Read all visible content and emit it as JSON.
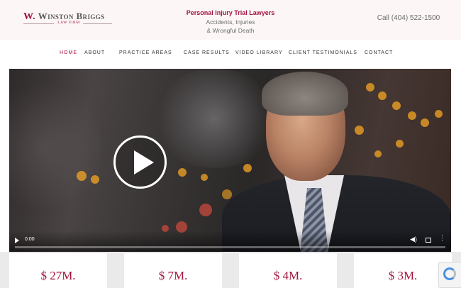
{
  "logo": {
    "initial": "W.",
    "name": "Winston Briggs",
    "sub": "LAW FIRM"
  },
  "tagline": {
    "line1": "Personal Injury Trial Lawyers",
    "line2": "Accidents, Injuries",
    "line3": "& Wrongful Death"
  },
  "phone": "Call (404) 522-1500",
  "nav": {
    "items": [
      "HOME",
      "ABOUT",
      "PRACTICE AREAS",
      "CASE RESULTS",
      "VIDEO LIBRARY",
      "CLIENT TESTIMONIALS",
      "CONTACT"
    ],
    "active": "HOME"
  },
  "video": {
    "time": "0:00"
  },
  "results": [
    "$ 27M.",
    "$ 7M.",
    "$ 4M.",
    "$ 3M."
  ],
  "colors": {
    "brand": "#a3143c",
    "header_bg": "#fcf6f7"
  },
  "icons": {
    "play": "play-icon",
    "volume": "volume-icon",
    "fullscreen": "fullscreen-icon",
    "more": "more-options-icon",
    "recaptcha": "recaptcha-icon"
  }
}
